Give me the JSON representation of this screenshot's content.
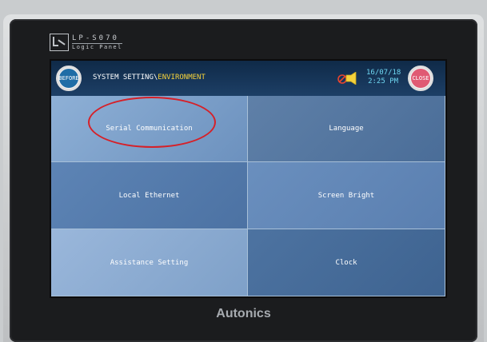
{
  "device": {
    "model": "LP-S070",
    "subtitle": "Logic Panel",
    "manufacturer": "Autonics"
  },
  "titlebar": {
    "before_label": "BEFORE",
    "path_prefix": "SYSTEM SETTING\\",
    "path_current": "ENVIRONMENT",
    "date": "16/07/18",
    "time": "2:25 PM",
    "close_label": "CLOSE"
  },
  "menu": {
    "items": [
      {
        "label": "Serial Communication"
      },
      {
        "label": "Language"
      },
      {
        "label": "Local Ethernet"
      },
      {
        "label": "Screen Bright"
      },
      {
        "label": "Assistance Setting"
      },
      {
        "label": "Clock"
      }
    ]
  },
  "colors": {
    "accent_path": "#f5d23b",
    "datetime": "#6fd7f2",
    "annotation": "#d62028",
    "close": "#e05a73",
    "before": "#1f6da6"
  },
  "icons": {
    "before": "back-arrow-icon",
    "warning": "buzzer-off-icon",
    "brand": "lp-logo-icon"
  }
}
